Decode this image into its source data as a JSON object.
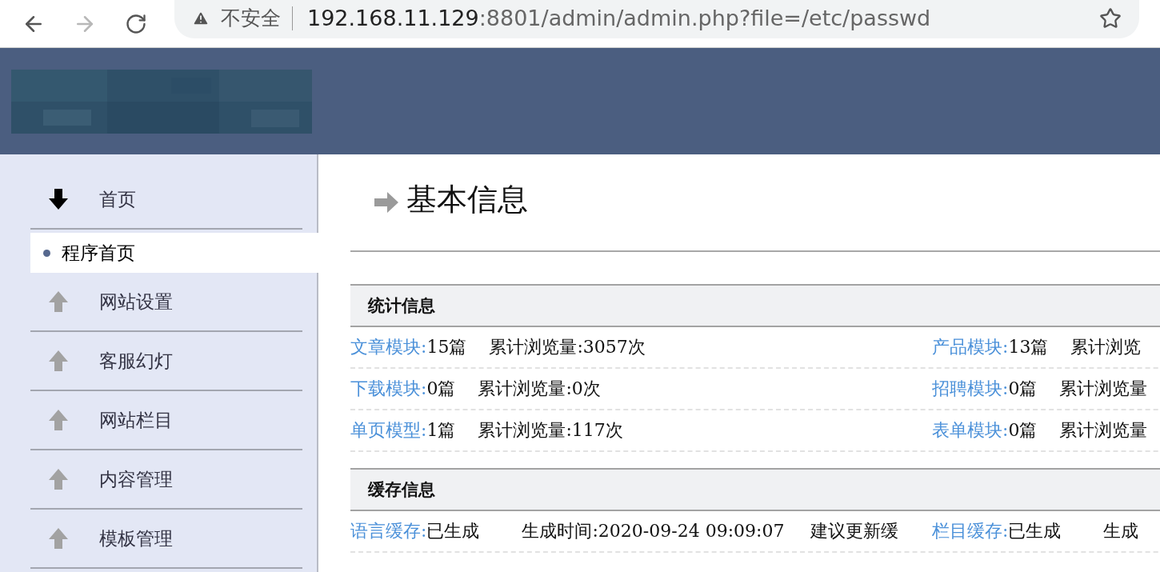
{
  "browser": {
    "nav_buttons": [
      {
        "kind": "back",
        "disabled": false
      },
      {
        "kind": "forward",
        "disabled": true
      },
      {
        "kind": "reload",
        "disabled": false
      }
    ],
    "security_label": "不安全",
    "url_host": "192.168.11.129",
    "url_rest": ":8801/admin/admin.php?file=/etc/passwd"
  },
  "sidebar": {
    "groups": [
      {
        "label": "首页",
        "expanded": true,
        "children": [
          {
            "label": "程序首页",
            "selected": true
          }
        ]
      },
      {
        "label": "网站设置",
        "expanded": false
      },
      {
        "label": "客服幻灯",
        "expanded": false
      },
      {
        "label": "网站栏目",
        "expanded": false
      },
      {
        "label": "内容管理",
        "expanded": false
      },
      {
        "label": "模板管理",
        "expanded": false
      }
    ]
  },
  "main": {
    "title": "基本信息",
    "sections": [
      {
        "title": "统计信息",
        "kind": "stats",
        "rows": [
          {
            "cells": [
              {
                "label": "文章模块:",
                "parts": [
                  "15篇",
                  "累计浏览量:3057次"
                ]
              },
              {
                "label": "产品模块:",
                "parts": [
                  "13篇",
                  "累计浏览"
                ]
              }
            ]
          },
          {
            "cells": [
              {
                "label": "下载模块:",
                "parts": [
                  "0篇",
                  "累计浏览量:0次"
                ]
              },
              {
                "label": "招聘模块:",
                "parts": [
                  "0篇",
                  "累计浏览量"
                ]
              }
            ]
          },
          {
            "cells": [
              {
                "label": "单页模型:",
                "parts": [
                  "1篇",
                  "累计浏览量:117次"
                ]
              },
              {
                "label": "表单模块:",
                "parts": [
                  "0篇",
                  "累计浏览量"
                ]
              }
            ]
          }
        ]
      },
      {
        "title": "缓存信息",
        "kind": "cache",
        "rows": [
          {
            "cells": [
              {
                "label": "语言缓存:",
                "parts": [
                  "已生成",
                  "生成时间:2020-09-24 09:09:07",
                  "建议更新缓"
                ]
              },
              {
                "label": "栏目缓存:",
                "parts": [
                  "已生成",
                  "生成"
                ]
              }
            ]
          }
        ]
      }
    ]
  }
}
